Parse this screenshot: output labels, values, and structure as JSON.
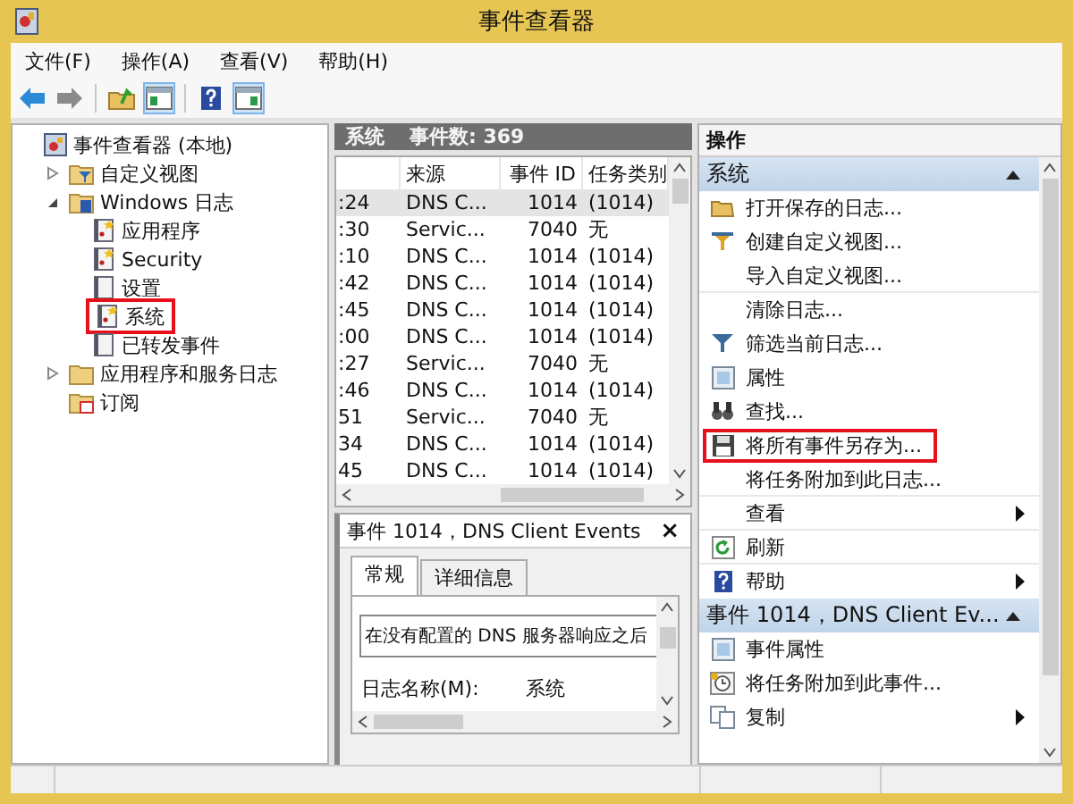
{
  "window": {
    "title": "事件查看器"
  },
  "menu": [
    "文件(F)",
    "操作(A)",
    "查看(V)",
    "帮助(H)"
  ],
  "toolbar": [
    {
      "pressed": false
    },
    {
      "pressed": false
    },
    {
      "pressed": false
    },
    {
      "pressed": true
    },
    {
      "pressed": false
    },
    {
      "pressed": true
    }
  ],
  "tree": [
    {
      "label": "事件查看器 (本地)",
      "kind": "root",
      "highlighted": false,
      "children": [
        {
          "label": "自定义视图",
          "kind": "filter-folder",
          "expanded": false,
          "highlighted": false
        },
        {
          "label": "Windows 日志",
          "kind": "log-folder",
          "expanded": true,
          "highlighted": false,
          "children": [
            {
              "label": "应用程序",
              "kind": "log",
              "highlighted": false
            },
            {
              "label": "Security",
              "kind": "log",
              "highlighted": false
            },
            {
              "label": "设置",
              "kind": "empty-log",
              "highlighted": false
            },
            {
              "label": "系统",
              "kind": "log",
              "highlighted": true
            },
            {
              "label": "已转发事件",
              "kind": "empty-log",
              "highlighted": false
            }
          ]
        },
        {
          "label": "应用程序和服务日志",
          "kind": "folder",
          "expanded": false,
          "highlighted": false
        },
        {
          "label": "订阅",
          "kind": "subscription",
          "highlighted": false
        }
      ]
    }
  ],
  "log_header": {
    "name": "系统",
    "count": "事件数: 369"
  },
  "table": {
    "columns": [
      "",
      "来源",
      "事件 ID",
      "任务类别"
    ],
    "rows": [
      {
        "cells": [
          ":24",
          "DNS C...",
          "1014",
          "(1014)"
        ],
        "selected": true
      },
      {
        "cells": [
          ":30",
          "Servic...",
          "7040",
          "无"
        ],
        "selected": false
      },
      {
        "cells": [
          ":10",
          "DNS C...",
          "1014",
          "(1014)"
        ],
        "selected": false
      },
      {
        "cells": [
          ":42",
          "DNS C...",
          "1014",
          "(1014)"
        ],
        "selected": false
      },
      {
        "cells": [
          ":45",
          "DNS C...",
          "1014",
          "(1014)"
        ],
        "selected": false
      },
      {
        "cells": [
          ":00",
          "DNS C...",
          "1014",
          "(1014)"
        ],
        "selected": false
      },
      {
        "cells": [
          ":27",
          "Servic...",
          "7040",
          "无"
        ],
        "selected": false
      },
      {
        "cells": [
          ":46",
          "DNS C...",
          "1014",
          "(1014)"
        ],
        "selected": false
      },
      {
        "cells": [
          "51",
          "Servic...",
          "7040",
          "无"
        ],
        "selected": false
      },
      {
        "cells": [
          "34",
          "DNS C...",
          "1014",
          "(1014)"
        ],
        "selected": false
      },
      {
        "cells": [
          "45",
          "DNS C...",
          "1014",
          "(1014)"
        ],
        "selected": false
      }
    ]
  },
  "detail": {
    "title": "事件 1014，DNS Client Events",
    "close": "×",
    "tabs": [
      {
        "label": "常规",
        "selected": true
      },
      {
        "label": "详细信息",
        "selected": false
      }
    ],
    "description": "在没有配置的 DNS 服务器响应之后",
    "field_label": "日志名称(M):",
    "field_value": "系统"
  },
  "actions": {
    "title": "操作",
    "sections": [
      {
        "title": "系统",
        "items": [
          {
            "label": "打开保存的日志...",
            "submenu": false,
            "divider": false,
            "highlighted": false
          },
          {
            "label": "创建自定义视图...",
            "submenu": false,
            "divider": false,
            "highlighted": false
          },
          {
            "label": "导入自定义视图...",
            "submenu": false,
            "divider": true,
            "highlighted": false
          },
          {
            "label": "清除日志...",
            "submenu": false,
            "divider": false,
            "highlighted": false
          },
          {
            "label": "筛选当前日志...",
            "submenu": false,
            "divider": false,
            "highlighted": false
          },
          {
            "label": "属性",
            "submenu": false,
            "divider": false,
            "highlighted": false
          },
          {
            "label": "查找...",
            "submenu": false,
            "divider": false,
            "highlighted": false
          },
          {
            "label": "将所有事件另存为...",
            "submenu": false,
            "divider": false,
            "highlighted": true
          },
          {
            "label": "将任务附加到此日志...",
            "submenu": false,
            "divider": true,
            "highlighted": false
          },
          {
            "label": "查看",
            "submenu": true,
            "divider": true,
            "highlighted": false
          },
          {
            "label": "刷新",
            "submenu": false,
            "divider": true,
            "highlighted": false
          },
          {
            "label": "帮助",
            "submenu": true,
            "divider": false,
            "highlighted": false
          }
        ]
      },
      {
        "title": "事件 1014，DNS Client Ev...",
        "items": [
          {
            "label": "事件属性",
            "submenu": false,
            "divider": false,
            "highlighted": false
          },
          {
            "label": "将任务附加到此事件...",
            "submenu": false,
            "divider": false,
            "highlighted": false
          },
          {
            "label": "复制",
            "submenu": true,
            "divider": false,
            "highlighted": false
          }
        ]
      }
    ]
  }
}
